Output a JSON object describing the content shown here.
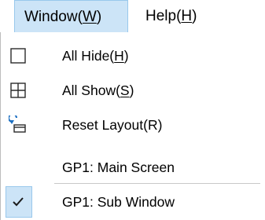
{
  "menubar": {
    "window": {
      "label": "Window(",
      "key": "W",
      "close": ")"
    },
    "help": {
      "label": "Help(",
      "key": "H",
      "close": ")"
    }
  },
  "menu": {
    "all_hide": {
      "label": "All Hide(",
      "key": "H",
      "close": ")",
      "icon": "square-icon"
    },
    "all_show": {
      "label": "All Show(",
      "key": "S",
      "close": ")",
      "icon": "grid-icon"
    },
    "reset_layout": {
      "label": "Reset Layout(R)",
      "icon": "reset-layout-icon"
    },
    "gp1_main": {
      "label": "GP1: Main Screen"
    },
    "gp1_sub": {
      "label": "GP1: Sub Window",
      "checked": true,
      "icon": "checkmark-icon"
    }
  },
  "colors": {
    "highlight": "#cce4f7",
    "highlight_border": "#99c8ec",
    "icon_accent": "#1a6ec2"
  }
}
